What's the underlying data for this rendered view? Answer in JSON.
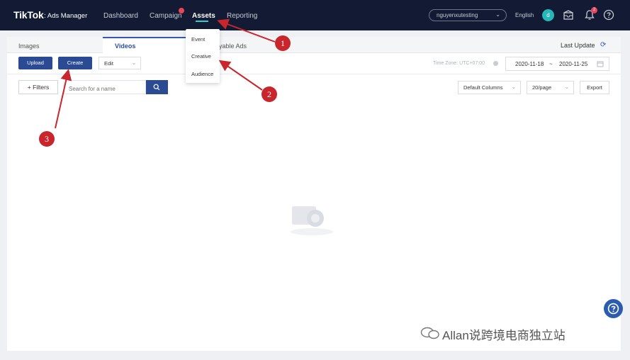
{
  "brand": {
    "logo": "TikTok",
    "logo_sub": ": Ads Manager"
  },
  "nav": {
    "dashboard": "Dashboard",
    "campaign": "Campaign",
    "assets": "Assets",
    "reporting": "Reporting"
  },
  "account": {
    "name": "nguyenxutesting",
    "language": "English",
    "avatar_letter": "d",
    "notification_count": "2"
  },
  "tabs": {
    "images": "Images",
    "videos": "Videos",
    "playable": "Playable Ads"
  },
  "header": {
    "last_update": "Last Update"
  },
  "toolbar": {
    "upload": "Upload",
    "create": "Create",
    "edit": "Edit",
    "timezone": "Time Zone: UTC+07:00",
    "date_start": "2020-11-18",
    "date_sep": "~",
    "date_end": "2020-11-25"
  },
  "filters": {
    "filters_label": "+ Filters",
    "search_placeholder": "Search for a name",
    "columns": "Default Columns",
    "page_size": "20/page",
    "export": "Export"
  },
  "assets_menu": {
    "items": [
      "Event",
      "Creative",
      "Audience"
    ]
  },
  "annotations": {
    "one": "1",
    "two": "2",
    "three": "3"
  },
  "watermark": {
    "text": "Allan说跨境电商独立站"
  },
  "colors": {
    "topbar": "#121b33",
    "primary": "#2b4a94",
    "accent": "#2bd0d0",
    "annotation": "#c8262c"
  }
}
